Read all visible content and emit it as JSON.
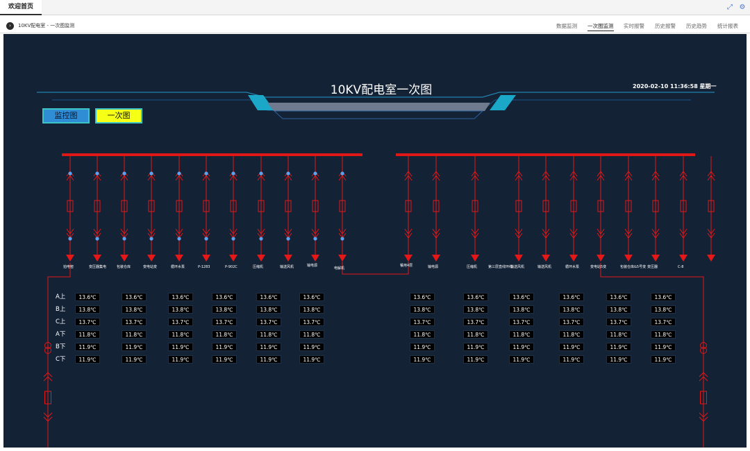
{
  "top_tabs": {
    "home_label": "欢迎首页"
  },
  "header": {
    "breadcrumb": "10KV配电室 - 一次图监测",
    "nav": [
      "数据监测",
      "一次图监测",
      "实时报警",
      "历史报警",
      "历史趋势",
      "统计报表"
    ],
    "active_nav": "一次图监测"
  },
  "main": {
    "title": "10KV配电室一次图",
    "datetime": "2020-02-10 11:36:58 星期一",
    "buttons": {
      "monitor": "监控图",
      "single_line": "一次图"
    }
  },
  "colors": {
    "background": "#142236",
    "busbar": "#e01717",
    "line": "#e51717",
    "node": "#5aa4ef",
    "button_monitor": "#2f8dd5",
    "button_single_line": "#f6ff16",
    "accent_bar": "#1aa7c8"
  },
  "icons": {
    "top_right": [
      "expand-icon",
      "settings-icon"
    ],
    "breadcrumb": "circle-arrow-icon"
  },
  "feeders": {
    "left": [
      "拍电窑",
      "变压器集电",
      "包装仓库",
      "变电站变",
      "循环水泵",
      "P-1283",
      "P-902C",
      "压缩机",
      "输送风机",
      "输电源",
      "电解机"
    ],
    "right": [
      "餐用4层",
      "输电源",
      "压缩机",
      "第三层直线环线",
      "输送风机",
      "输送风机",
      "循环水泵",
      "变电站5变",
      "包装仓库&5号变",
      "变压器",
      "C-8"
    ]
  },
  "temperature_table": {
    "phases": [
      "A上",
      "B上",
      "C上",
      "A下",
      "B下",
      "C下"
    ],
    "left_values": [
      [
        "13.6℃",
        "13.6℃",
        "13.6℃",
        "13.6℃",
        "13.6℃",
        "13.6℃"
      ],
      [
        "13.8℃",
        "13.8℃",
        "13.8℃",
        "13.8℃",
        "13.8℃",
        "13.8℃"
      ],
      [
        "13.7℃",
        "13.7℃",
        "13.7℃",
        "13.7℃",
        "13.7℃",
        "13.7℃"
      ],
      [
        "11.8℃",
        "11.8℃",
        "11.8℃",
        "11.8℃",
        "11.8℃",
        "11.8℃"
      ],
      [
        "11.9℃",
        "11.9℃",
        "11.9℃",
        "11.9℃",
        "11.9℃",
        "11.9℃"
      ],
      [
        "11.9℃",
        "11.9℃",
        "11.9℃",
        "11.9℃",
        "11.9℃",
        "11.9℃"
      ]
    ],
    "right_values": [
      [
        "13.6℃",
        "13.6℃",
        "13.6℃",
        "13.6℃",
        "13.6℃",
        "13.6℃"
      ],
      [
        "13.8℃",
        "13.8℃",
        "13.8℃",
        "13.8℃",
        "13.8℃",
        "13.8℃"
      ],
      [
        "13.7℃",
        "13.7℃",
        "13.7℃",
        "13.7℃",
        "13.7℃",
        "13.7℃"
      ],
      [
        "11.8℃",
        "11.8℃",
        "11.8℃",
        "11.8℃",
        "11.8℃",
        "11.8℃"
      ],
      [
        "11.9℃",
        "11.9℃",
        "11.9℃",
        "11.9℃",
        "11.9℃",
        "11.9℃"
      ],
      [
        "11.9℃",
        "11.9℃",
        "11.9℃",
        "11.9℃",
        "11.9℃",
        "11.9℃"
      ]
    ]
  }
}
